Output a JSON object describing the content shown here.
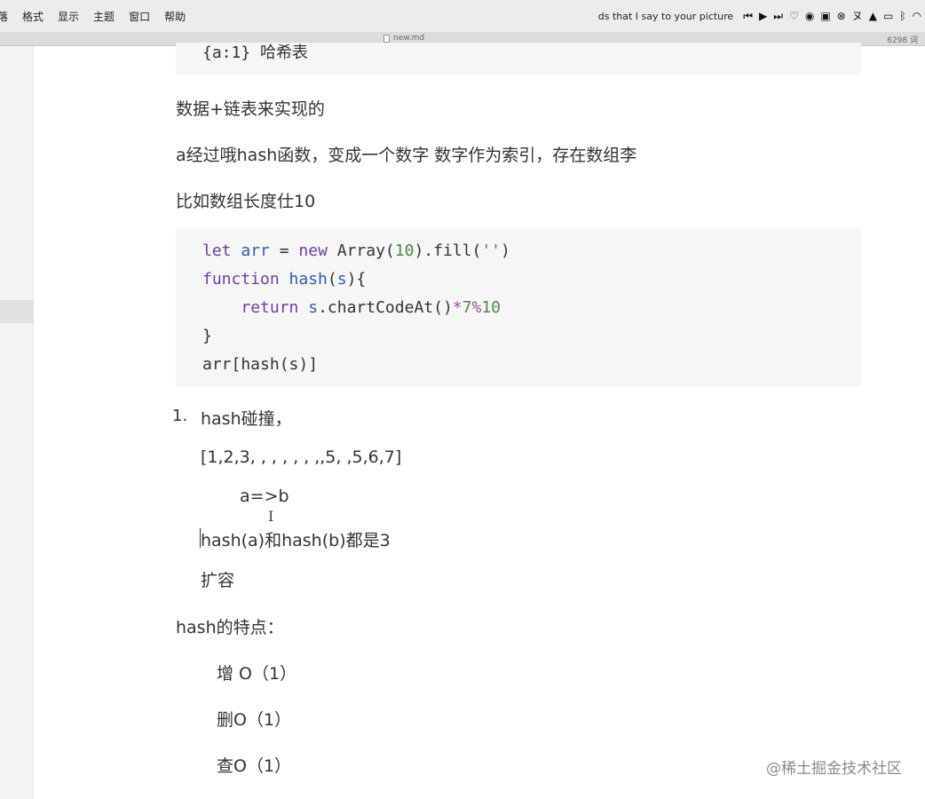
{
  "menubar": {
    "items": [
      "落",
      "格式",
      "显示",
      "主题",
      "窗口",
      "帮助"
    ],
    "now_playing": "ds that I say to your picture"
  },
  "titlebar": {
    "filename": "new.md",
    "word_count": "6298 词"
  },
  "document": {
    "code_top": "{a:1} 哈希表",
    "para1": "数据+链表来实现的",
    "para2": "a经过哦hash函数，变成一个数字  数字作为索引，存在数组李",
    "para3": "比如数组长度仕10",
    "code_lines": [
      "let arr = new Array(10).fill('')",
      "function hash(s){",
      "    return s.chartCodeAt()*7%10",
      "}",
      "arr[hash(s)]"
    ],
    "list_number": "1.",
    "list_item1": "hash碰撞，",
    "array_text": "[1,2,3, , , , , , ,,5, ,5,6,7]",
    "arrow_text": "a=>b",
    "collision_text": "hash(a)和hash(b)都是3",
    "expand_text": "扩容",
    "features_heading": "hash的特点：",
    "feature_add": "增 O（1）",
    "feature_delete": "删O（1）",
    "feature_query": "查O（1）"
  },
  "watermark": "@稀土掘金技术社区"
}
